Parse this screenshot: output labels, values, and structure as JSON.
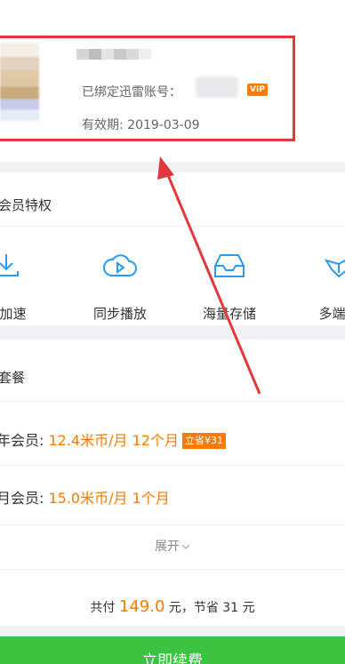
{
  "account": {
    "bound_label": "已绑定迅雷账号：",
    "vip_badge": "VIP",
    "validity": "有效期: 2019-03-09"
  },
  "privileges": {
    "title": "会员特权",
    "items": [
      {
        "label": "载加速",
        "icon": "download-icon"
      },
      {
        "label": "同步播放",
        "icon": "play-icon"
      },
      {
        "label": "海量存储",
        "icon": "storage-icon"
      },
      {
        "label": "多端文",
        "icon": "multi-device-icon"
      }
    ]
  },
  "packages": {
    "title": "套餐",
    "options": [
      {
        "prefix": "年会员: ",
        "price": "12.4米币/月 12个月",
        "badge": "立省¥31"
      },
      {
        "prefix": "月会员: ",
        "price": "15.0米币/月 1个月",
        "badge": ""
      }
    ],
    "expand_label": "展开",
    "total_prefix": "共付 ",
    "total_amount": "149.0",
    "total_suffix": " 元，节省 31 元"
  },
  "renew_button": "立即续费",
  "colors": {
    "accent": "#ff7a00",
    "primary_green": "#3cc341",
    "annotation_red": "#e03a3f"
  }
}
